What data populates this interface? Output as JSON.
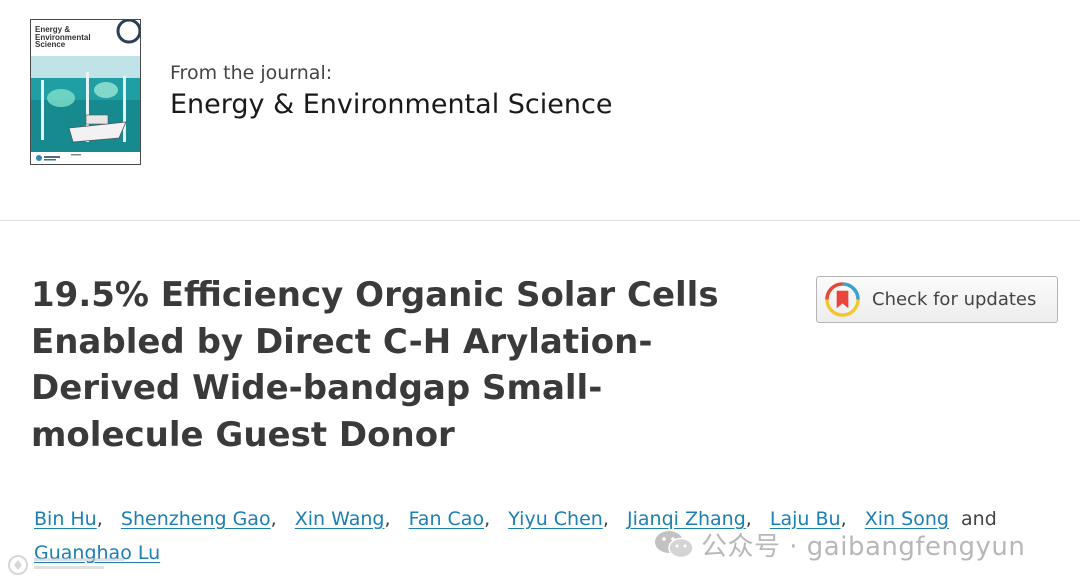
{
  "journal": {
    "from_label": "From the journal:",
    "name": "Energy & Environmental Science",
    "cover_title": "Energy & Environmental Science"
  },
  "article": {
    "title_lines": [
      "19.5% Efficiency Organic Solar Cells",
      "Enabled by Direct C-H Arylation-",
      "Derived Wide-bandgap Small-",
      "molecule Guest Donor"
    ],
    "check_updates_label": "Check for updates",
    "authors": [
      "Bin Hu",
      "Shenzheng Gao",
      "Xin Wang",
      "Fan Cao",
      "Yiyu Chen",
      "Jianqi Zhang",
      "Laju Bu",
      "Xin Song",
      "Guanghao Lu"
    ],
    "author_separator": ",",
    "author_and": "and"
  },
  "watermark": {
    "text": "公众号 · gaibangfengyun",
    "icon": "wechat-icon"
  },
  "colors": {
    "link": "#1b7fb3",
    "title": "#3a3a3a",
    "divider": "#dddddd"
  }
}
